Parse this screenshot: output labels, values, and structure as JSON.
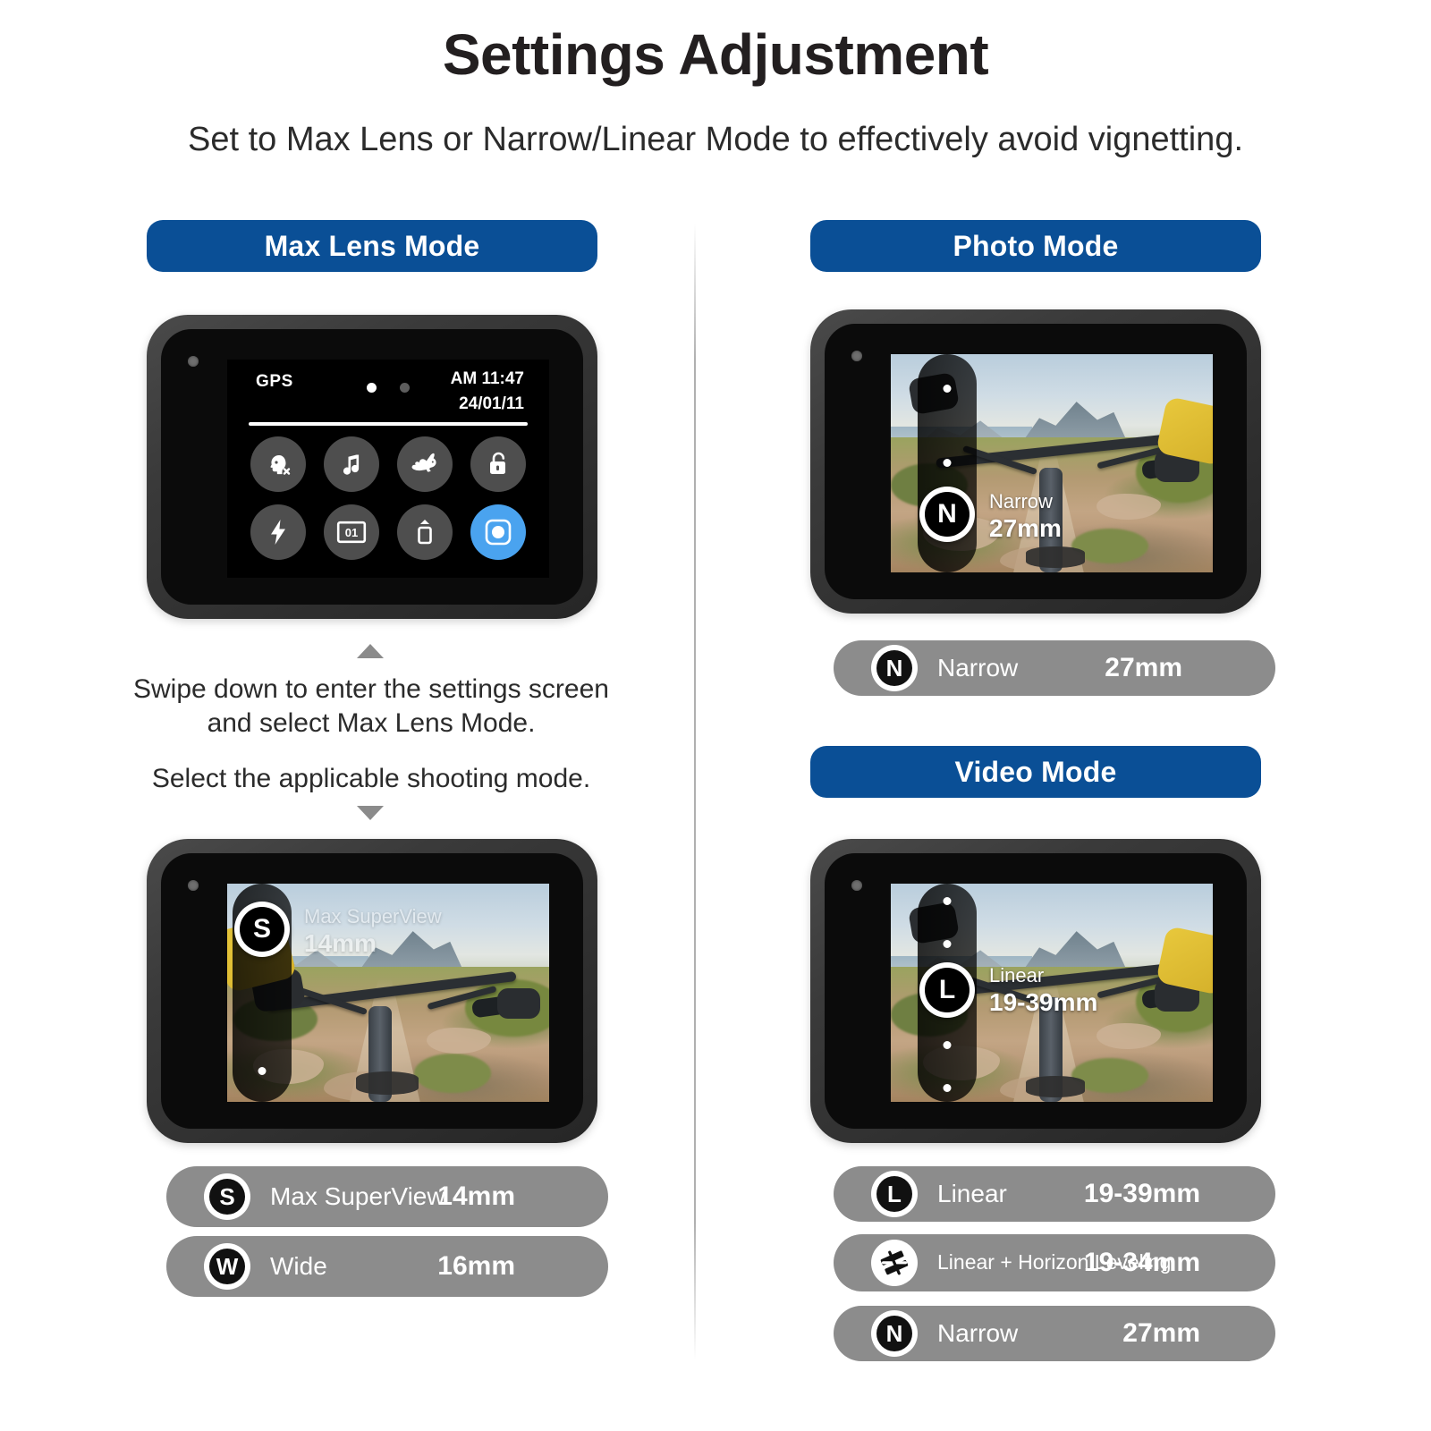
{
  "header": {
    "title": "Settings Adjustment",
    "subtitle": "Set to Max Lens or Narrow/Linear Mode to effectively avoid vignetting."
  },
  "colors": {
    "accent_blue": "#0a4f96",
    "pill_gray": "#8c8c8c",
    "active_tile_blue": "#4aa3ef",
    "text_dark": "#231f20"
  },
  "left_column": {
    "heading": "Max Lens Mode",
    "settings_screen": {
      "status": {
        "gps_label": "GPS",
        "time": "AM 11:47",
        "date": "24/01/11",
        "page_dots": 2,
        "active_dot_index": 0
      },
      "tiles": [
        {
          "name": "voice-control-off-icon",
          "row": 1
        },
        {
          "name": "beeps-sound-icon",
          "row": 1
        },
        {
          "name": "hyper-speed-rabbit-icon",
          "row": 1
        },
        {
          "name": "screen-unlock-icon",
          "row": 1
        },
        {
          "name": "flash-icon",
          "row": 2
        },
        {
          "name": "frame-counter-01-icon",
          "row": 2
        },
        {
          "name": "screen-orientation-icon",
          "row": 2
        },
        {
          "name": "max-lens-mode-icon",
          "row": 2,
          "active": true
        }
      ]
    },
    "note_1": "Swipe down to enter the settings screen and select Max Lens Mode.",
    "note_2": "Select the applicable shooting mode.",
    "preview_overlay": {
      "mode": "Max SuperView",
      "focal": "14mm",
      "badge": "S"
    },
    "specs": [
      {
        "badge": "S",
        "name": "Max SuperView",
        "value": "14mm"
      },
      {
        "badge": "W",
        "name": "Wide",
        "value": "16mm"
      }
    ]
  },
  "right_column": {
    "photo": {
      "heading": "Photo Mode",
      "preview_overlay": {
        "mode": "Narrow",
        "focal": "27mm",
        "badge": "N"
      },
      "specs": [
        {
          "badge": "N",
          "name": "Narrow",
          "value": "27mm"
        }
      ]
    },
    "video": {
      "heading": "Video Mode",
      "preview_overlay": {
        "mode": "Linear",
        "focal": "19-39mm",
        "badge": "L"
      },
      "specs": [
        {
          "badge": "L",
          "name": "Linear",
          "value": "19-39mm"
        },
        {
          "badge": "horizon-leveling-icon",
          "name": "Linear + Horizon Leveling",
          "value": "19-34mm"
        },
        {
          "badge": "N",
          "name": "Narrow",
          "value": "27mm"
        }
      ]
    }
  }
}
